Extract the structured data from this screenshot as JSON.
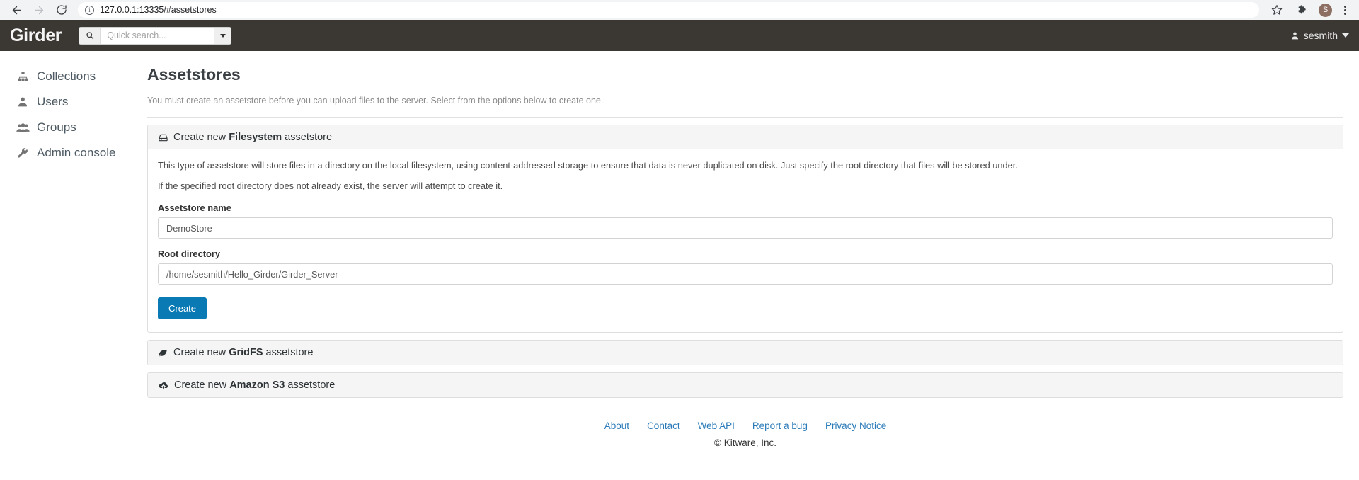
{
  "browser": {
    "url": "127.0.0.1:13335/#assetstores",
    "back_label": "Back",
    "forward_label": "Forward",
    "reload_label": "Reload",
    "bookmark_label": "Bookmark this tab",
    "extensions_label": "Extensions",
    "profile_initial": "S",
    "menu_label": "Customize and control Chromium"
  },
  "navbar": {
    "brand": "Girder",
    "search_placeholder": "Quick search...",
    "search_value": "",
    "user": "sesmith"
  },
  "sidebar": {
    "items": [
      {
        "label": "Collections",
        "icon": "sitemap-icon"
      },
      {
        "label": "Users",
        "icon": "user-icon"
      },
      {
        "label": "Groups",
        "icon": "users-icon"
      },
      {
        "label": "Admin console",
        "icon": "wrench-icon"
      }
    ]
  },
  "main": {
    "title": "Assetstores",
    "subtitle": "You must create an assetstore before you can upload files to the server. Select from the options below to create one.",
    "panels": [
      {
        "head_prefix": "Create new ",
        "head_strong": "Filesystem",
        "head_suffix": " assetstore",
        "icon": "hard-drive-icon",
        "expanded": true,
        "paragraphs": [
          "This type of assetstore will store files in a directory on the local filesystem, using content-addressed storage to ensure that data is never duplicated on disk. Just specify the root directory that files will be stored under.",
          "If the specified root directory does not already exist, the server will attempt to create it."
        ],
        "fields": [
          {
            "label": "Assetstore name",
            "value": "DemoStore",
            "placeholder": ""
          },
          {
            "label": "Root directory",
            "value": "/home/sesmith/Hello_Girder/Girder_Server",
            "placeholder": ""
          }
        ],
        "submit_label": "Create"
      },
      {
        "head_prefix": "Create new ",
        "head_strong": "GridFS",
        "head_suffix": " assetstore",
        "icon": "leaf-icon",
        "expanded": false
      },
      {
        "head_prefix": "Create new ",
        "head_strong": "Amazon S3",
        "head_suffix": " assetstore",
        "icon": "cloud-upload-icon",
        "expanded": false
      }
    ]
  },
  "footer": {
    "links": [
      "About",
      "Contact",
      "Web API",
      "Report a bug",
      "Privacy Notice"
    ],
    "copyright": "© Kitware, Inc."
  },
  "colors": {
    "navbar_bg": "#3b3834",
    "primary": "#0a7ab5",
    "link": "#2b7bb9",
    "panel_head_bg": "#f5f5f5"
  }
}
